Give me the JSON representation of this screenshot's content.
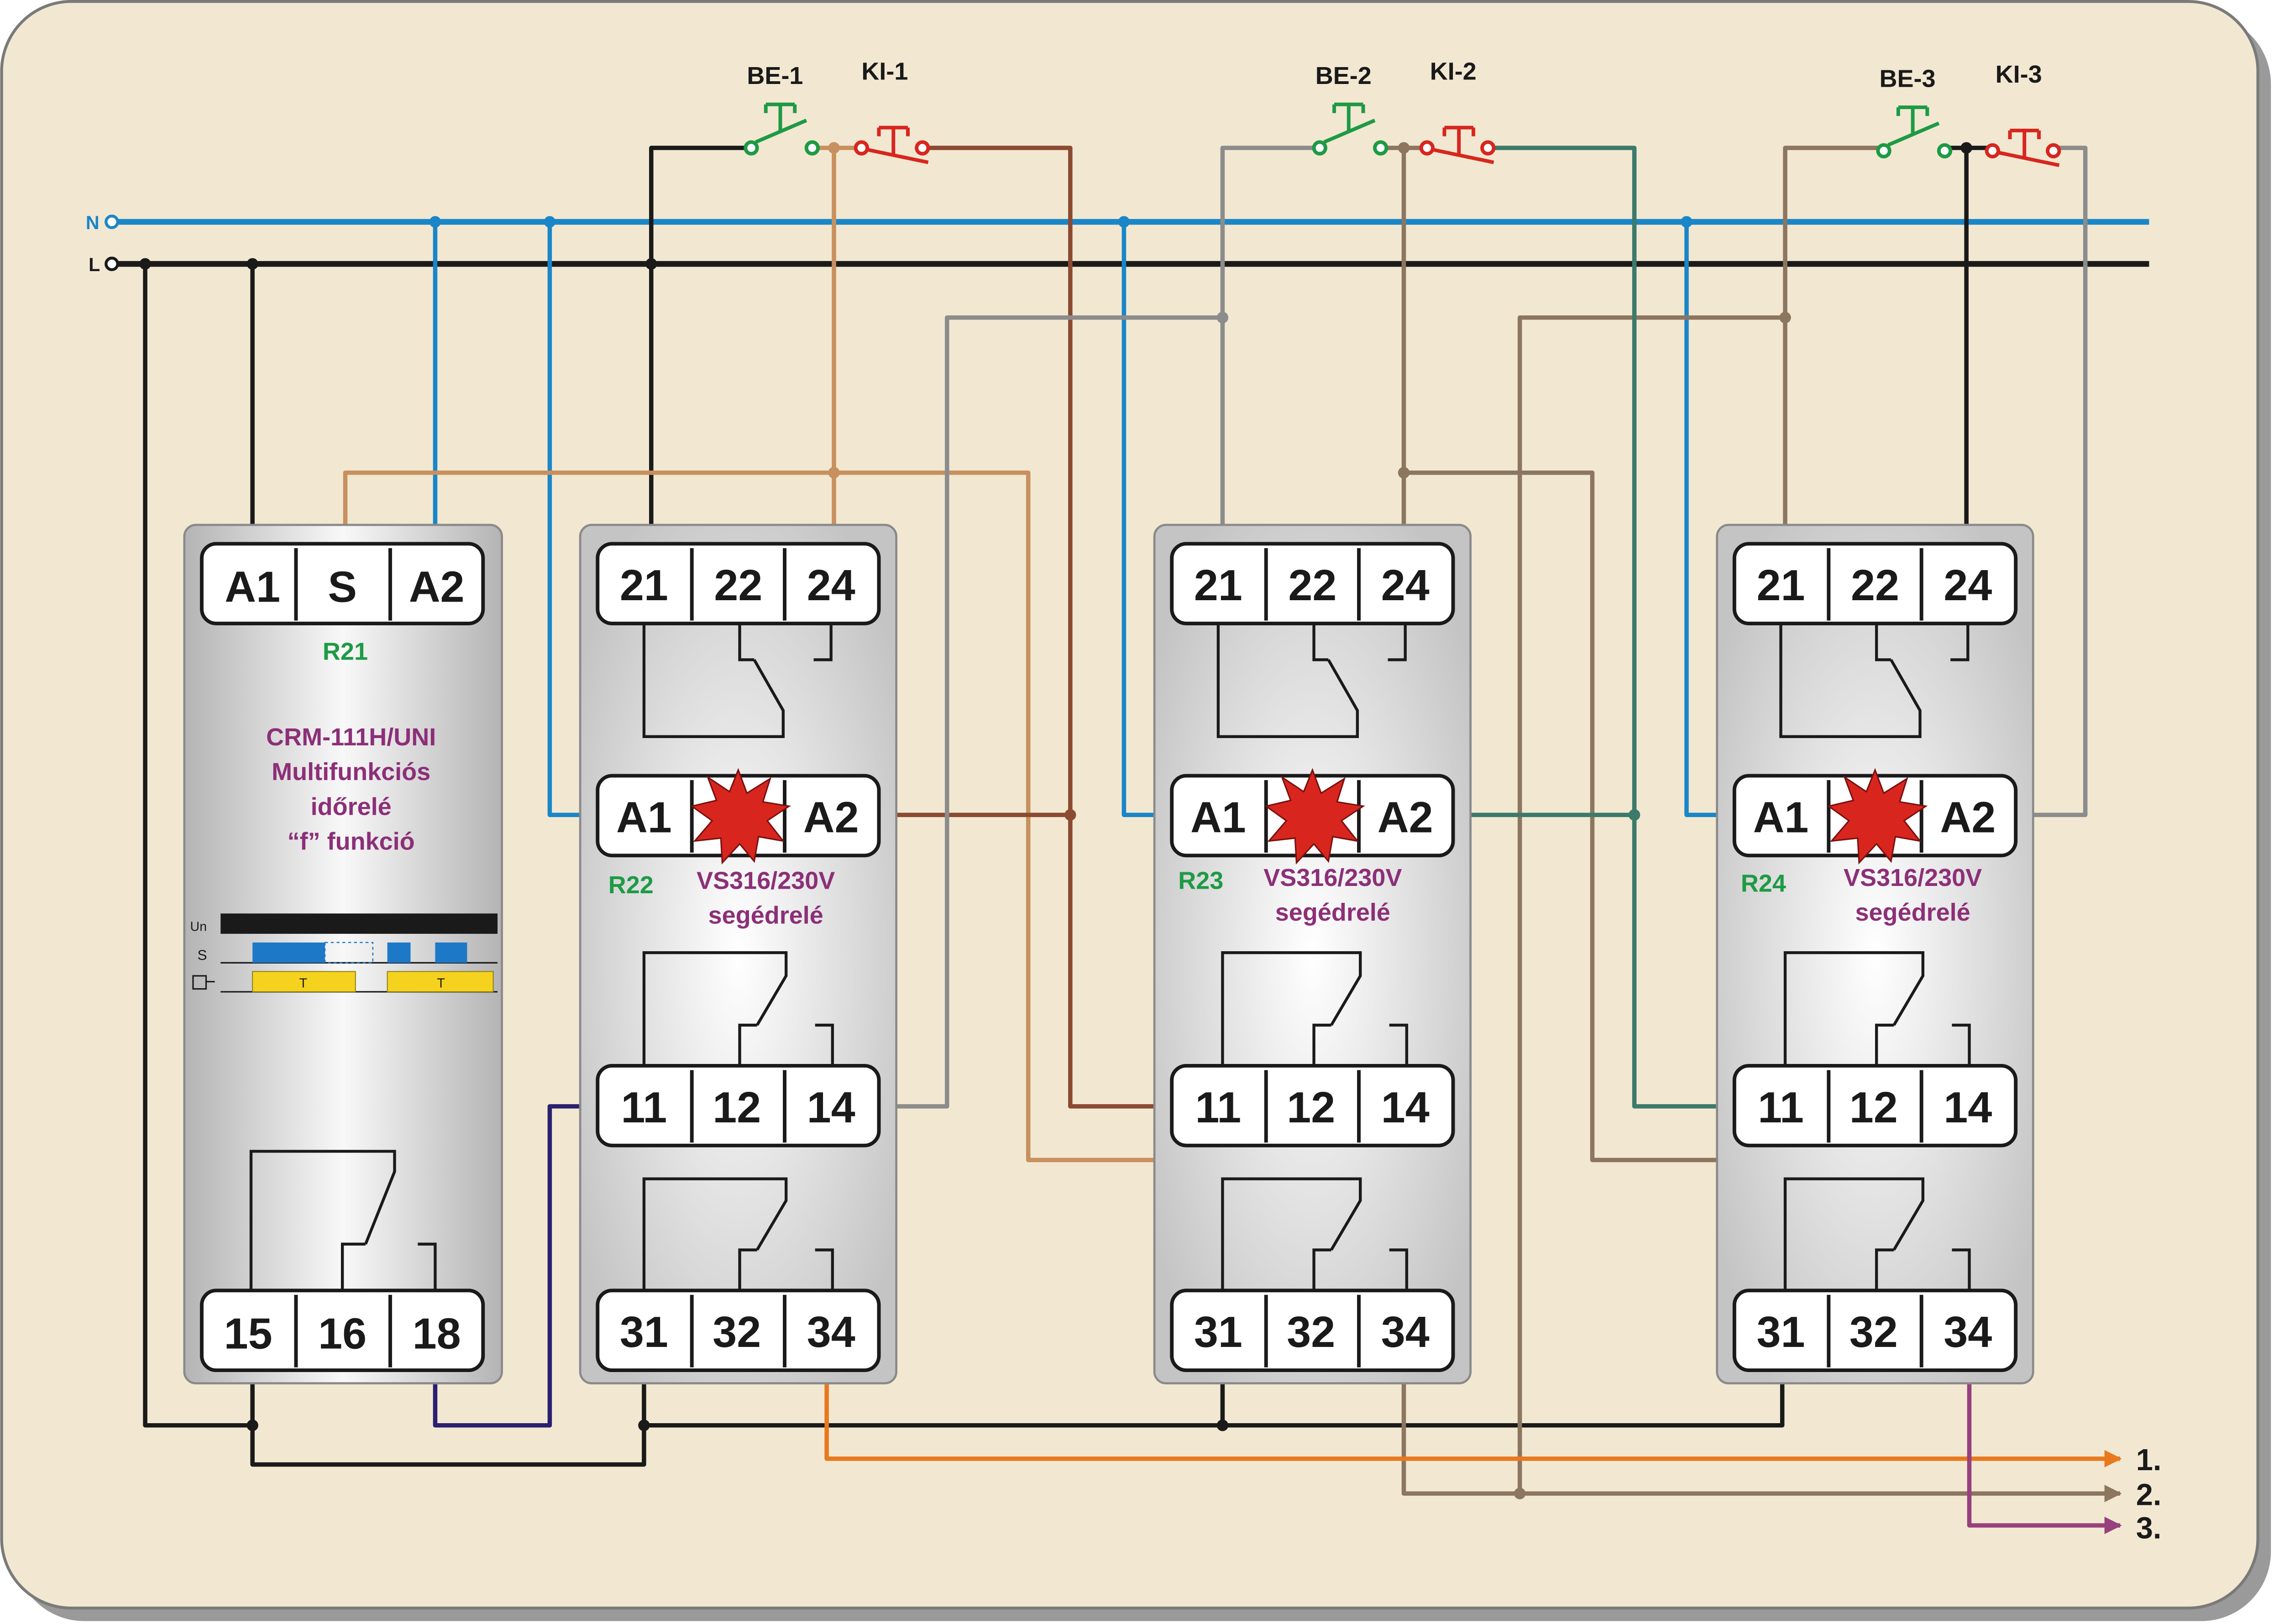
{
  "supply": {
    "n_label": "N",
    "l_label": "L"
  },
  "buttons": [
    {
      "be": "BE-1",
      "ki": "KI-1"
    },
    {
      "be": "BE-2",
      "ki": "KI-2"
    },
    {
      "be": "BE-3",
      "ki": "KI-3"
    }
  ],
  "timer": {
    "terminals_top": [
      "A1",
      "S",
      "A2"
    ],
    "terminals_bottom": [
      "15",
      "16",
      "18"
    ],
    "ref": "R21",
    "desc": [
      "CRM-111H/UNI",
      "Multifunkciós",
      "időrelé",
      "“f” funkció"
    ],
    "timing": {
      "un": "Un",
      "s": "S",
      "t1": "T",
      "t2": "T"
    }
  },
  "aux_relays": [
    {
      "ref": "R22",
      "top": [
        "21",
        "22",
        "24"
      ],
      "coil": [
        "A1",
        "A2"
      ],
      "mid": [
        "11",
        "12",
        "14"
      ],
      "bottom": [
        "31",
        "32",
        "34"
      ],
      "desc": [
        "VS316/230V",
        "segédrelé"
      ]
    },
    {
      "ref": "R23",
      "top": [
        "21",
        "22",
        "24"
      ],
      "coil": [
        "A1",
        "A2"
      ],
      "mid": [
        "11",
        "12",
        "14"
      ],
      "bottom": [
        "31",
        "32",
        "34"
      ],
      "desc": [
        "VS316/230V",
        "segédrelé"
      ]
    },
    {
      "ref": "R24",
      "top": [
        "21",
        "22",
        "24"
      ],
      "coil": [
        "A1",
        "A2"
      ],
      "mid": [
        "11",
        "12",
        "14"
      ],
      "bottom": [
        "31",
        "32",
        "34"
      ],
      "desc": [
        "VS316/230V",
        "segédrelé"
      ]
    }
  ],
  "outputs": [
    "1.",
    "2.",
    "3."
  ],
  "colors": {
    "background": "#f2e8d2",
    "n_line": "#1a86c8",
    "l_line": "#1a1a1a",
    "start_button": "#1e9a45",
    "stop_button": "#d8261e",
    "tan": "#c8905e",
    "brown": "#8b4a32",
    "grey": "#8c8c8c",
    "taupe": "#8c7660",
    "teal": "#3c7a6a",
    "navy": "#2a1f70",
    "orange": "#e8791e",
    "purple": "#98407e",
    "label_green": "#1e9a45",
    "label_purple": "#8c2f78"
  }
}
